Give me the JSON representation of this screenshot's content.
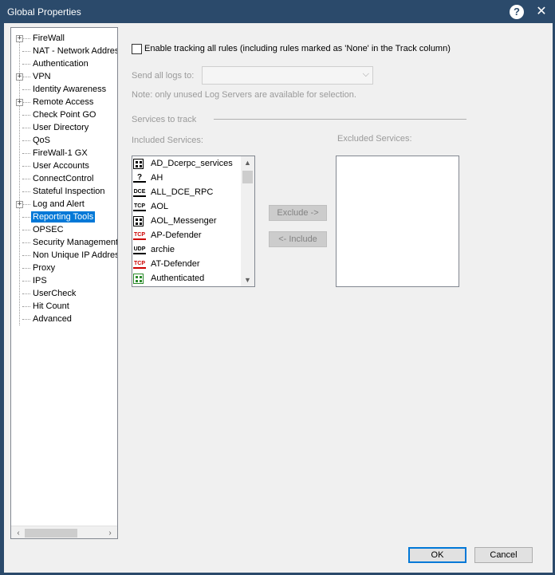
{
  "window": {
    "title": "Global Properties",
    "help_glyph": "?",
    "close_glyph": "✕"
  },
  "tree": {
    "items": [
      {
        "label": "FireWall",
        "expandable": true
      },
      {
        "label": "NAT - Network Addres",
        "expandable": false
      },
      {
        "label": "Authentication",
        "expandable": false
      },
      {
        "label": "VPN",
        "expandable": true
      },
      {
        "label": "Identity Awareness",
        "expandable": false
      },
      {
        "label": "Remote Access",
        "expandable": true
      },
      {
        "label": "Check Point GO",
        "expandable": false
      },
      {
        "label": "User Directory",
        "expandable": false
      },
      {
        "label": "QoS",
        "expandable": false
      },
      {
        "label": "FireWall-1 GX",
        "expandable": false
      },
      {
        "label": "User Accounts",
        "expandable": false
      },
      {
        "label": "ConnectControl",
        "expandable": false
      },
      {
        "label": "Stateful Inspection",
        "expandable": false
      },
      {
        "label": "Log and Alert",
        "expandable": true
      },
      {
        "label": "Reporting Tools",
        "expandable": false,
        "selected": true
      },
      {
        "label": "OPSEC",
        "expandable": false
      },
      {
        "label": "Security Management ...",
        "expandable": false
      },
      {
        "label": "Non Unique IP Address",
        "expandable": false
      },
      {
        "label": "Proxy",
        "expandable": false
      },
      {
        "label": "IPS",
        "expandable": false
      },
      {
        "label": "UserCheck",
        "expandable": false
      },
      {
        "label": "Hit Count",
        "expandable": false
      },
      {
        "label": "Advanced",
        "expandable": false
      }
    ],
    "expander_glyph": "+",
    "scroll_left": "‹",
    "scroll_right": "›"
  },
  "panel": {
    "enable_tracking_label": "Enable tracking all rules (including rules marked as 'None' in the Track column)",
    "enable_tracking_checked": false,
    "send_logs_label": "Send all logs to:",
    "send_logs_value": "",
    "send_logs_chevron": "⌵",
    "note": "Note: only unused Log Servers are available for selection.",
    "services_to_track": "Services to track",
    "included_label": "Included Services:",
    "excluded_label": "Excluded Services:",
    "included_services": [
      {
        "name": "AD_Dcerpc_services",
        "icon": "group-icon",
        "icon_text": ""
      },
      {
        "name": "AH",
        "icon": "other-service-icon",
        "icon_text": "?"
      },
      {
        "name": "ALL_DCE_RPC",
        "icon": "dce-service-icon",
        "icon_text": "DCE"
      },
      {
        "name": "AOL",
        "icon": "tcp-service-icon",
        "icon_text": "TCP"
      },
      {
        "name": "AOL_Messenger",
        "icon": "group-icon",
        "icon_text": ""
      },
      {
        "name": "AP-Defender",
        "icon": "tcp-service-red-icon",
        "icon_text": "TCP"
      },
      {
        "name": "archie",
        "icon": "udp-service-icon",
        "icon_text": "UDP"
      },
      {
        "name": "AT-Defender",
        "icon": "tcp-service-red-icon",
        "icon_text": "TCP"
      },
      {
        "name": "Authenticated",
        "icon": "group-green-icon",
        "icon_text": ""
      }
    ],
    "excluded_services": [],
    "scroll_up": "▲",
    "scroll_down": "▼",
    "exclude_button": "Exclude ->",
    "include_button": "<- Include"
  },
  "footer": {
    "ok": "OK",
    "cancel": "Cancel"
  },
  "colors": {
    "titlebar": "#2b4a6b",
    "selection": "#0078d7",
    "disabled_text": "#9a9a9a"
  }
}
